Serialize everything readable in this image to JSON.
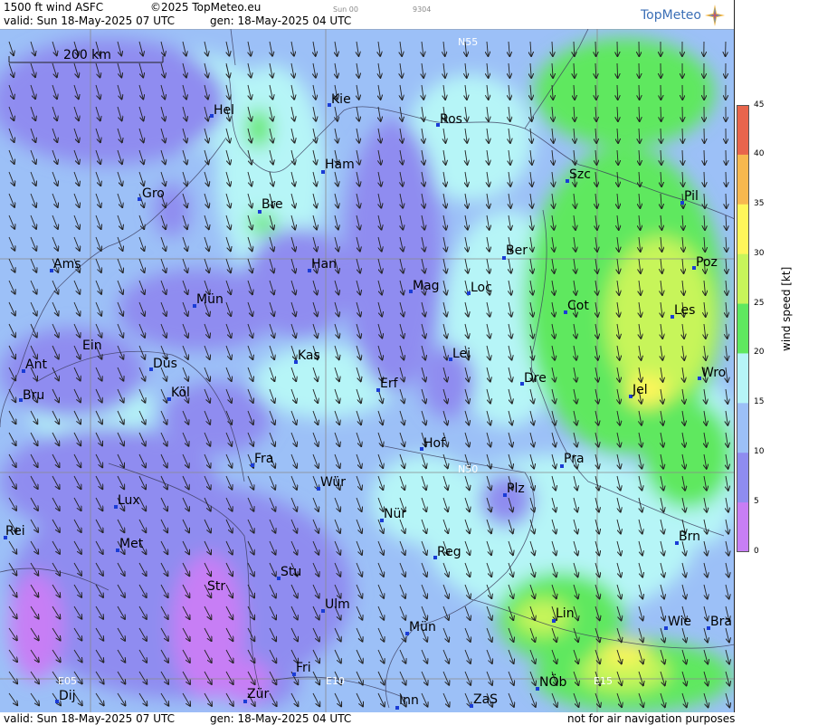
{
  "header": {
    "product": "1500 ft wind ASFC",
    "copyright": "©2025 TopMeteo.eu",
    "run": "Sun 00",
    "code": "9304",
    "valid": "valid:  Sun  18-May-2025  07 UTC",
    "generated": "gen: 18-May-2025 04 UTC"
  },
  "logo": {
    "text": "TopMeteo",
    "icon": "compass-star-icon"
  },
  "scale_bar": {
    "label": "200 km"
  },
  "grid_labels": [
    "N55",
    "N50",
    "E05",
    "E10",
    "E15"
  ],
  "cities": [
    {
      "name": "Hel"
    },
    {
      "name": "Kie"
    },
    {
      "name": "Ros"
    },
    {
      "name": "Ham"
    },
    {
      "name": "Gro"
    },
    {
      "name": "Bre"
    },
    {
      "name": "Szc"
    },
    {
      "name": "Pil"
    },
    {
      "name": "Ber"
    },
    {
      "name": "Poz"
    },
    {
      "name": "Ams"
    },
    {
      "name": "Han"
    },
    {
      "name": "Mag"
    },
    {
      "name": "Loc"
    },
    {
      "name": "Cot"
    },
    {
      "name": "Les"
    },
    {
      "name": "Mün"
    },
    {
      "name": "Ein"
    },
    {
      "name": "Kas"
    },
    {
      "name": "Lei"
    },
    {
      "name": "Wro"
    },
    {
      "name": "Ant"
    },
    {
      "name": "Düs"
    },
    {
      "name": "Dre"
    },
    {
      "name": "Bru"
    },
    {
      "name": "Köl"
    },
    {
      "name": "Erf"
    },
    {
      "name": "Jel"
    },
    {
      "name": "Hof"
    },
    {
      "name": "Fra"
    },
    {
      "name": "Pra"
    },
    {
      "name": "Lux"
    },
    {
      "name": "Wür"
    },
    {
      "name": "Plz"
    },
    {
      "name": "Rei"
    },
    {
      "name": "Nür"
    },
    {
      "name": "Met"
    },
    {
      "name": "Brn"
    },
    {
      "name": "Reg"
    },
    {
      "name": "Stu"
    },
    {
      "name": "Str"
    },
    {
      "name": "Ulm"
    },
    {
      "name": "Lin"
    },
    {
      "name": "Wie"
    },
    {
      "name": "Bra"
    },
    {
      "name": "Mün"
    },
    {
      "name": "Fri"
    },
    {
      "name": "NÖb"
    },
    {
      "name": "Dij"
    },
    {
      "name": "Zür"
    },
    {
      "name": "Inn"
    },
    {
      "name": "ZaS"
    }
  ],
  "colorbar": {
    "title": "wind speed  [kt]",
    "ticks": [
      "45",
      "40",
      "35",
      "30",
      "25",
      "20",
      "15",
      "10",
      "5",
      "0"
    ],
    "colors": {
      "0_5": "#c77ef5",
      "5_10": "#8f8cf0",
      "10_15": "#9cc0f7",
      "15_20": "#b6f5f7",
      "20_25": "#5fe85f",
      "25_30": "#c7f55a",
      "30_35": "#fff65a",
      "35_40": "#f7b84f",
      "40_45": "#e8654c"
    }
  },
  "footer": {
    "valid": "valid:  Sun  18-May-2025  07 UTC",
    "generated": "gen: 18-May-2025 04 UTC",
    "note": "not for air navigation purposes"
  }
}
